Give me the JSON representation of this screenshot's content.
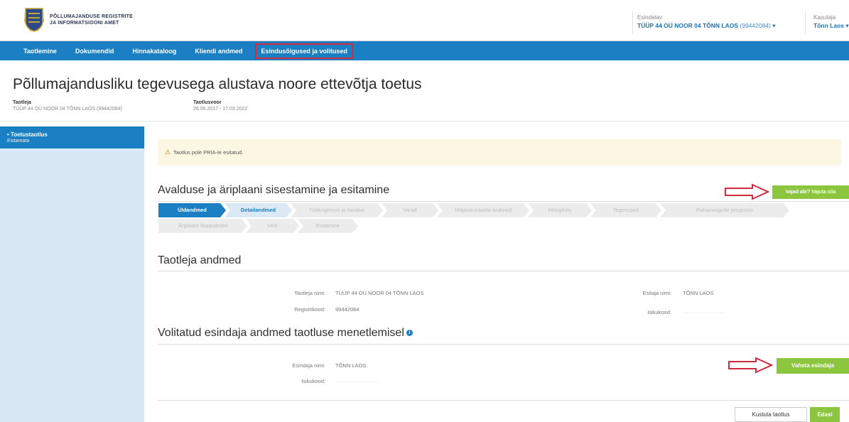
{
  "header": {
    "org_line1": "PÕLLUMAJANDUSE REGISTRITE",
    "org_line2": "JA INFORMATSIOONI AMET",
    "representative_label": "Esindatav",
    "representative_value": "TÜÜP 44 OÜ NOOR 04 TÕNN LAOS",
    "representative_code": "(99442084)",
    "representative_caret": "▾",
    "user_label": "Kasutaja",
    "user_value": "Tõnn Laos",
    "user_caret": "▾"
  },
  "nav": {
    "items": [
      {
        "label": "Taotlemine"
      },
      {
        "label": "Dokumendid"
      },
      {
        "label": "Hinnakataloog"
      },
      {
        "label": "Kliendi andmed"
      },
      {
        "label": "Esindusõigused ja volitused"
      }
    ]
  },
  "page": {
    "title": "Põllumajandusliku tegevusega alustava noore ettevõtja toetus",
    "applicant_label": "Taotleja",
    "applicant_value": "TÜÜP 44 OÜ NOOR 04 TÕNN LAOS (99442084)",
    "round_label": "Taotlusvoor",
    "round_value": "26.06.2017 - 17.03.2022"
  },
  "sidebar": {
    "items": [
      {
        "title": "• Toetustaotlus",
        "subtitle": "Esitamata"
      }
    ]
  },
  "warning": {
    "icon": "⚠",
    "text": "Taotlus pole PRIA-le esitatud."
  },
  "section1": {
    "title": "Avalduse ja äriplaani sisestamine ja esitamine",
    "help_button": "Vajad abi? Vajuta siia"
  },
  "steps": [
    {
      "label": "Üldandmed"
    },
    {
      "label": "Detailandmed"
    },
    {
      "label": "Töökogemus ja haridus"
    },
    {
      "label": "Varad"
    },
    {
      "label": "Majandusaasta andmed"
    },
    {
      "label": "Müügitulu"
    },
    {
      "label": "Tegevused"
    },
    {
      "label": "Rahavoogude prognoos"
    },
    {
      "label": "Äriplaani lisaandmed"
    },
    {
      "label": "VKE"
    },
    {
      "label": "Esitamine"
    }
  ],
  "applicant_section": {
    "title": "Taotleja andmed",
    "name_label": "Taotleja nimi:",
    "name_value": "TÜÜP 44 OÜ NOOR 04 TÕNN LAOS",
    "regcode_label": "Registrikood:",
    "regcode_value": "99442084",
    "submitter_label": "Esitaja nimi:",
    "submitter_value": "TÕNN LAOS",
    "idcode_label": "Isikukood:"
  },
  "representative_section": {
    "title": "Volitatud esindaja andmed taotluse menetlemisel",
    "info_icon": "i",
    "name_label": "Esindaja nimi:",
    "name_value": "TÕNN LAOS",
    "idcode_label": "Isikukood:",
    "change_button": "Vaheta esindaja"
  },
  "footer": {
    "delete_button": "Kustuta taotlus",
    "next_button": "Edasi"
  },
  "colors": {
    "brand_blue": "#1a7fc3",
    "accent_green": "#8cc63f",
    "highlight_red": "#d02b3f"
  }
}
